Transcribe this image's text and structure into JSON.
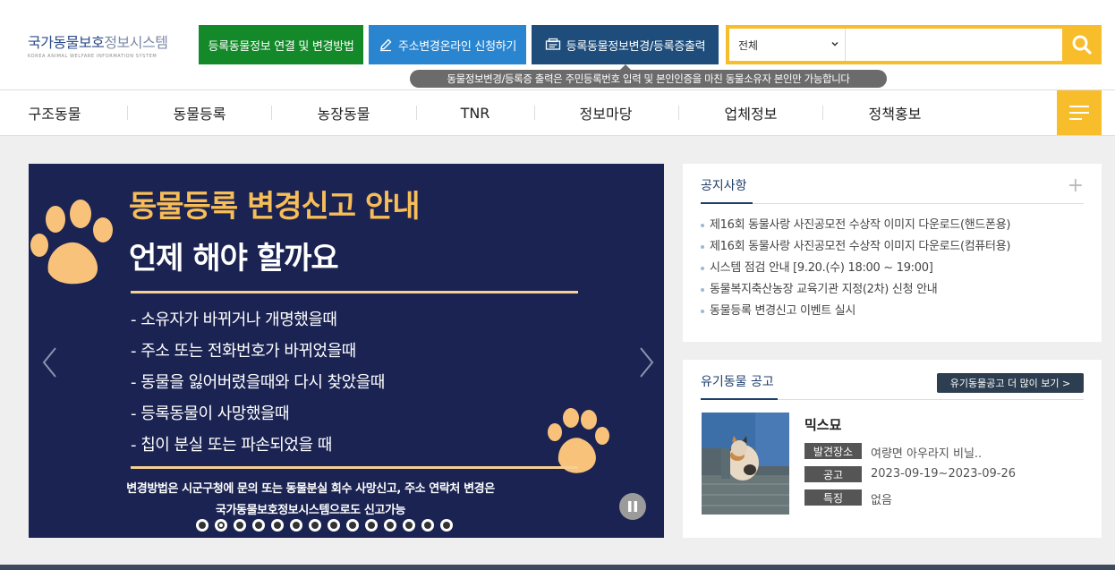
{
  "logo": {
    "main_a": "국가동물보호",
    "main_b": "정보시스템",
    "sub": "KOREA ANIMAL WELFARE INFORMATION SYSTEM"
  },
  "header_buttons": {
    "link_info": "등록동물정보 연결 및 변경방법",
    "address_change": "주소변경온라인 신청하기",
    "registration_change": "등록동물정보변경/등록증출력"
  },
  "search": {
    "scope": "전체",
    "placeholder": ""
  },
  "tooltip": "동물정보변경/등록증 출력은 주민등록번호 입력 및 본인인증을 마친 동물소유자 본인만 가능합니다",
  "nav": {
    "items": [
      "구조동물",
      "동물등록",
      "농장동물",
      "TNR",
      "정보마당",
      "업체정보",
      "정책홍보"
    ]
  },
  "banner": {
    "title1": "동물등록 변경신고 안내",
    "title2": "언제 해야 할까요",
    "items": [
      "- 소유자가 바뀌거나 개명했을때",
      "- 주소 또는 전화번호가 바뀌었을때",
      "- 동물을 잃어버렸을때와 다시 찾았을때",
      "- 등록동물이 사망했을때",
      "- 칩이 분실 또는 파손되었을 때"
    ],
    "note1": "변경방법은 시군구청에 문의 또는 동물분실 회수 사망신고, 주소 연락처 변경은",
    "note2": "국가동물보호정보시스템으로도 신고가능",
    "dot_count": 14,
    "active_dot": 2
  },
  "notice": {
    "title": "공지사항",
    "items": [
      "제16회 동물사랑 사진공모전 수상작 이미지 다운로드(핸드폰용)",
      "제16회 동물사랑 사진공모전 수상작 이미지 다운로드(컴퓨터용)",
      "시스템 점검 안내 [9.20.(수) 18:00 ~ 19:00]",
      "동물복지축산농장 교육기관 지정(2차) 신청 안내",
      "동물등록 변경신고 이벤트 실시"
    ]
  },
  "animal": {
    "title": "유기동물 공고",
    "more": "유기동물공고 더 많이 보기 >",
    "name": "믹스묘",
    "found_label": "발견장소",
    "found_value": "여량면 아우라지 비닐..",
    "notice_label": "공고",
    "notice_value": "2023-09-19~2023-09-26",
    "feature_label": "특징",
    "feature_value": "없음"
  },
  "colors": {
    "accent_yellow": "#f8bd2b",
    "banner_bg": "#1b2352",
    "green": "#14892a",
    "blue": "#2a85d0",
    "navy": "#1e4d7b"
  }
}
